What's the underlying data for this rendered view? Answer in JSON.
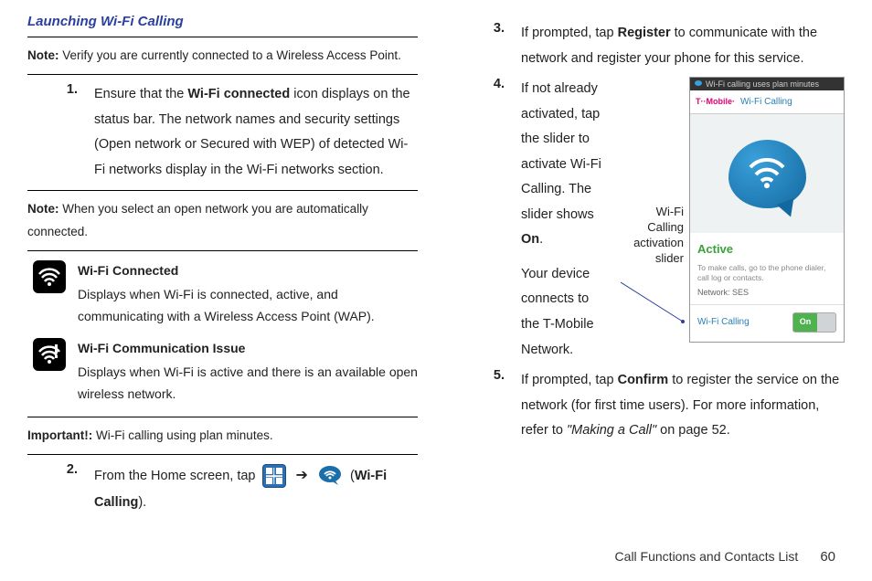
{
  "heading": "Launching Wi-Fi Calling",
  "notes": {
    "n1_label": "Note:",
    "n1_text": " Verify you are currently connected to a Wireless Access Point.",
    "n2_label": "Note:",
    "n2_text": " When you select an open network you are automatically connected.",
    "imp_label": "Important!:",
    "imp_text": " Wi-Fi calling using plan minutes."
  },
  "steps": {
    "s1_num": "1.",
    "s1_a": "Ensure that the ",
    "s1_b": "Wi-Fi connected",
    "s1_c": " icon displays on the status bar. The network names and security settings (Open network or Secured with WEP) of detected Wi-Fi networks display in the Wi-Fi networks section.",
    "s2_num": "2.",
    "s2_a": "From the Home screen, tap ",
    "s2_b": "Wi-Fi Calling",
    "s3_num": "3.",
    "s3_a": "If prompted, tap ",
    "s3_b": "Register",
    "s3_c": " to communicate with the network and register your phone for this service.",
    "s4_num": "4.",
    "s4_a": "If not already activated, tap the slider to activate Wi-Fi Calling. The slider shows ",
    "s4_b": "On",
    "s4_c": ".",
    "s4_d": "Your device connects to the T-Mobile Network.",
    "s5_num": "5.",
    "s5_a": "If prompted, tap ",
    "s5_b": "Confirm",
    "s5_c": "  to register the service on the network (for first time users). For more information, refer to ",
    "s5_d": "\"Making a Call\"",
    "s5_e": "  on page 52."
  },
  "icons": {
    "connected_title": "Wi-Fi Connected",
    "connected_text": "Displays when Wi-Fi is connected, active, and communicating with a Wireless Access Point (WAP).",
    "issue_title": "Wi-Fi Communication Issue",
    "issue_text": "Displays when Wi-Fi is active and there is an available open wireless network."
  },
  "callout": "Wi-Fi Calling activation slider",
  "phone": {
    "status": "Wi-Fi calling uses plan minutes",
    "carrier": "T··Mobile·",
    "feature": "Wi-Fi Calling",
    "active": "Active",
    "sub": "To make calls, go to the phone dialer, call log or contacts.",
    "net": "Network: SES",
    "slider_label": "Wi-Fi Calling",
    "on": "On"
  },
  "footer": {
    "section": "Call Functions and Contacts List",
    "page": "60"
  }
}
